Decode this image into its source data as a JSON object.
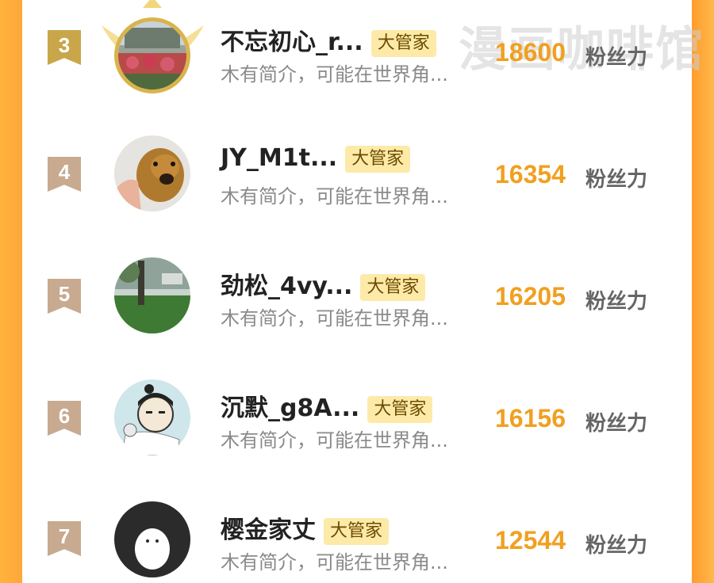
{
  "watermark": "漫画咖啡馆",
  "badge_label": "大管家",
  "unit_label": "粉丝力",
  "rows": [
    {
      "rank": "3",
      "name": "不忘初心_r...",
      "bio": "木有简介，可能在世界角...",
      "score": "18600"
    },
    {
      "rank": "4",
      "name": "JY_M1t...",
      "bio": "木有简介，可能在世界角...",
      "score": "16354"
    },
    {
      "rank": "5",
      "name": "劲松_4vy...",
      "bio": "木有简介，可能在世界角...",
      "score": "16205"
    },
    {
      "rank": "6",
      "name": "沉默_g8A...",
      "bio": "木有简介，可能在世界角...",
      "score": "16156"
    },
    {
      "rank": "7",
      "name": "樱金家丈",
      "bio": "木有简介，可能在世界角...",
      "score": "12544"
    }
  ],
  "colors": {
    "accent": "#f0a020",
    "badge_bg": "#fdeaa8",
    "rank_gold": "#c9a64a",
    "rank_plain": "#c7aa8f"
  }
}
